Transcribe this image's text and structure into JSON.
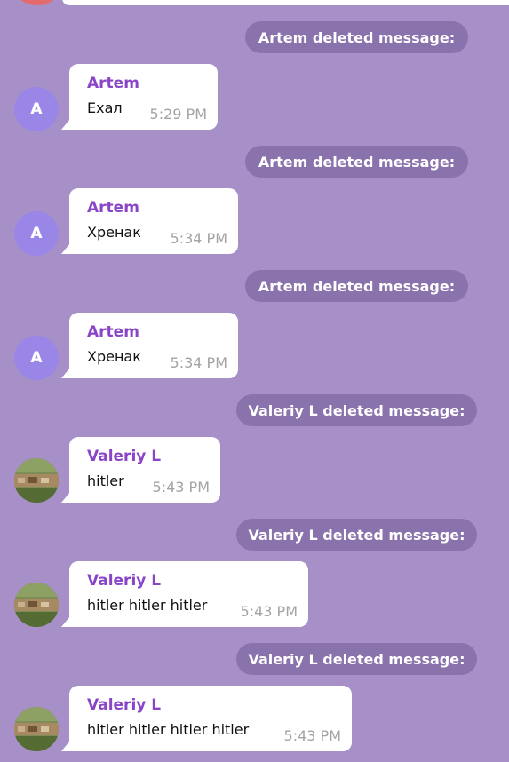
{
  "colors": {
    "background": "#a690c7",
    "system_pill": "#8a72ac",
    "sender_name": "#8a44c8",
    "letter_avatar": "#9a86e6",
    "timestamp": "#a3a3a3"
  },
  "messages": [
    {
      "system": "Artem deleted message:",
      "sender": "Artem",
      "avatar_letter": "A",
      "avatar_type": "letter",
      "text": "Ехал",
      "time": "5:29 PM"
    },
    {
      "system": "Artem deleted message:",
      "sender": "Artem",
      "avatar_letter": "A",
      "avatar_type": "letter",
      "text": "Хренак",
      "time": "5:34 PM"
    },
    {
      "system": "Artem deleted message:",
      "sender": "Artem",
      "avatar_letter": "A",
      "avatar_type": "letter",
      "text": "Хренак",
      "time": "5:34 PM"
    },
    {
      "system": "Valeriy L deleted message:",
      "sender": "Valeriy L",
      "avatar_type": "photo",
      "text": "hitler",
      "time": "5:43 PM"
    },
    {
      "system": "Valeriy L deleted message:",
      "sender": "Valeriy L",
      "avatar_type": "photo",
      "text": "hitler hitler hitler",
      "time": "5:43 PM"
    },
    {
      "system": "Valeriy L deleted message:",
      "sender": "Valeriy L",
      "avatar_type": "photo",
      "text": "hitler hitler hitler hitler",
      "time": "5:43 PM"
    }
  ]
}
